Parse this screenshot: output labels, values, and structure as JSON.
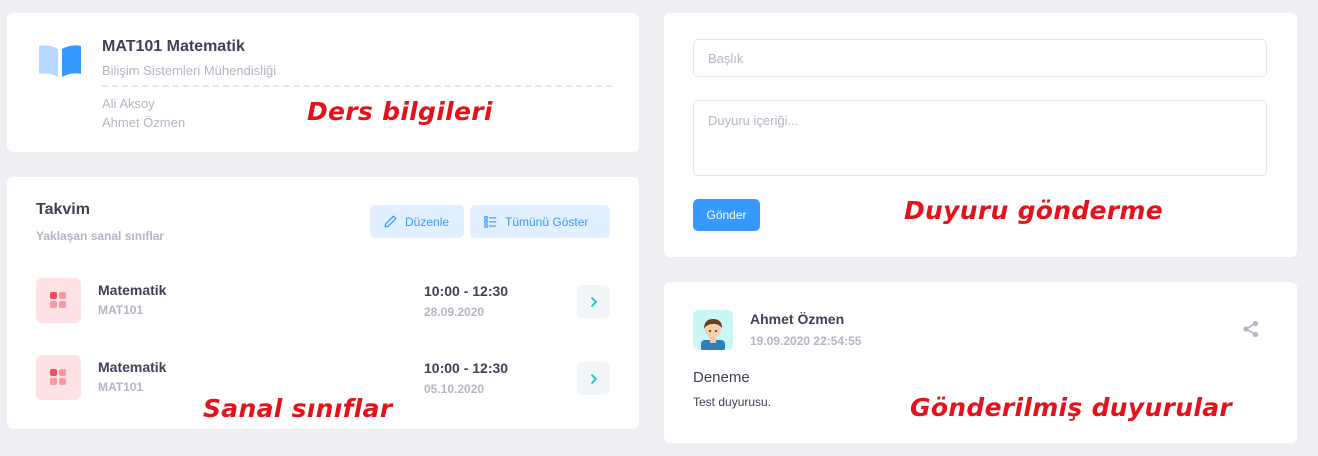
{
  "course": {
    "title": "MAT101 Matematik",
    "department": "Bilişim Sistemleri Mühendisliği",
    "teachers": [
      "Ali Aksoy",
      "Ahmet Özmen"
    ]
  },
  "calendar": {
    "title": "Takvim",
    "subtitle": "Yaklaşan sanal sınıflar",
    "edit_label": "Düzenle",
    "show_all_label": "Tümünü Göster",
    "classes": [
      {
        "name": "Matematik",
        "code": "MAT101",
        "time": "10:00 - 12:30",
        "date": "28.09.2020"
      },
      {
        "name": "Matematik",
        "code": "MAT101",
        "time": "10:00 - 12:30",
        "date": "05.10.2020"
      }
    ]
  },
  "form": {
    "title_placeholder": "Başlık",
    "body_placeholder": "Duyuru içeriği...",
    "send_label": "Gönder"
  },
  "post": {
    "author": "Ahmet Özmen",
    "time": "19.09.2020 22:54:55",
    "title": "Deneme",
    "body": "Test duyurusu."
  },
  "annotations": {
    "course": "Ders bilgileri",
    "classes": "Sanal sınıflar",
    "send": "Duyuru gönderme",
    "posts": "Gönderilmiş duyurular"
  },
  "colors": {
    "primary": "#3699ff",
    "danger": "#f64e60",
    "annotation": "#e3121b"
  }
}
